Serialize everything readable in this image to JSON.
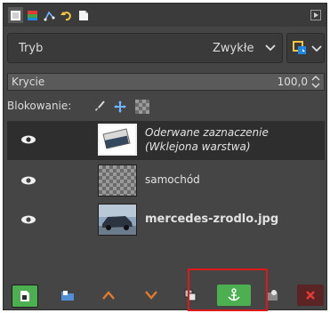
{
  "tabs": [
    {
      "icon": "layers-icon"
    },
    {
      "icon": "channels-icon"
    },
    {
      "icon": "paths-icon"
    },
    {
      "icon": "undo-history-icon"
    },
    {
      "icon": "document-icon"
    }
  ],
  "mode": {
    "label": "Tryb",
    "value": "Zwykłe"
  },
  "opacity": {
    "label": "Krycie",
    "value": "100,0"
  },
  "lock": {
    "label": "Blokowanie:"
  },
  "layers": [
    {
      "name_line1": "Oderwane zaznaczenie",
      "name_line2": "(Wklejona warstwa)",
      "visible": true,
      "active": true
    },
    {
      "name": "samochód",
      "visible": true,
      "active": false
    },
    {
      "name": "mercedes-zrodlo.jpg",
      "visible": true,
      "active": false
    }
  ],
  "colors": {
    "panel_bg": "#454545",
    "active_row": "#2e2e2e",
    "anchor_button": "#4caf50",
    "new_layer_button": "#4caf50",
    "delete_button": "#e53935",
    "highlight_box": "#e01818"
  }
}
